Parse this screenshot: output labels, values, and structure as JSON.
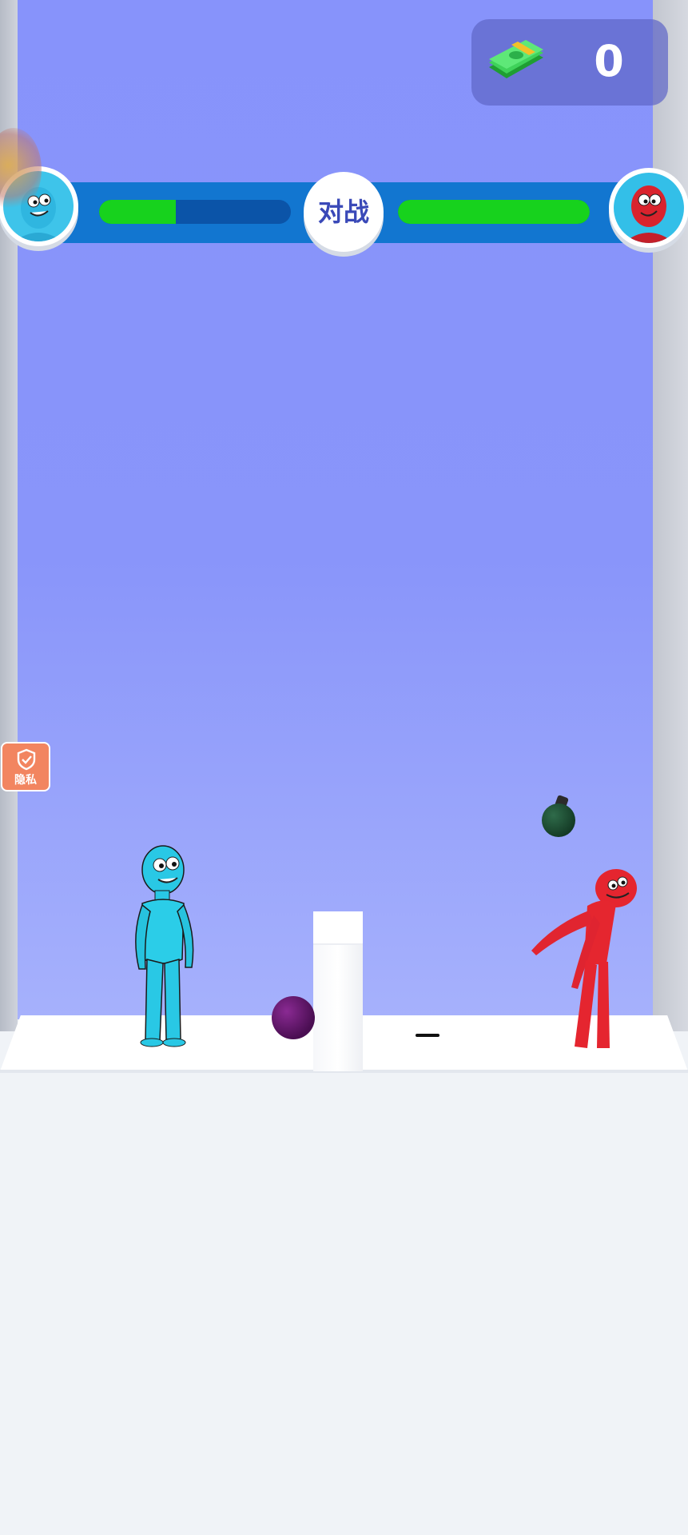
{
  "hud": {
    "currency": {
      "icon": "cash-stack-icon",
      "value": "0"
    },
    "battle": {
      "label": "对战",
      "player": {
        "avatar": "blue-character-avatar",
        "health_fraction": 0.4
      },
      "opponent": {
        "avatar": "red-character-avatar",
        "health_fraction": 1.0
      }
    }
  },
  "privacy": {
    "label": "隐私",
    "icon": "shield-check-icon"
  },
  "colors": {
    "sky": "#8995fa",
    "health": "#17d21d",
    "band": "#1276d0",
    "player": "#27c6e3",
    "opponent": "#e5252f",
    "privacy": "#f28560"
  }
}
